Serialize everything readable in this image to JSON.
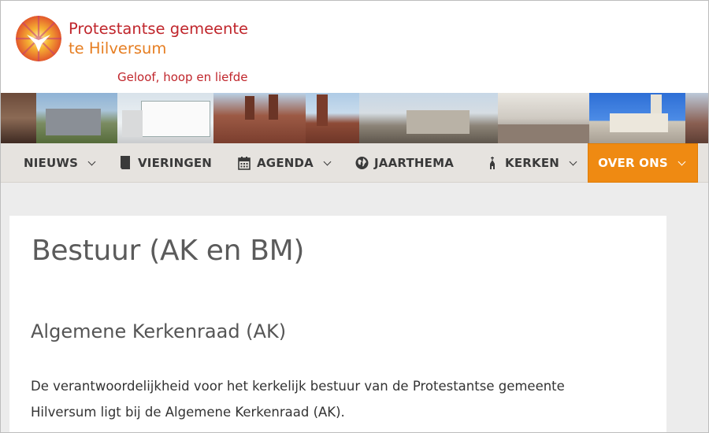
{
  "header": {
    "site_name_line1": "Protestantse gemeente",
    "site_name_line2": "te Hilversum",
    "tagline": "Geloof, hoop en liefde"
  },
  "nav": {
    "items": [
      {
        "label": "NIEUWS",
        "icon": "none",
        "dropdown": true
      },
      {
        "label": "VIERINGEN",
        "icon": "book-icon",
        "dropdown": false
      },
      {
        "label": "AGENDA",
        "icon": "calendar-icon",
        "dropdown": true
      },
      {
        "label": "JAARTHEMA",
        "icon": "globe-icon",
        "dropdown": false
      },
      {
        "label": "KERKEN",
        "icon": "church-icon",
        "dropdown": true
      },
      {
        "label": "OVER ONS",
        "icon": "none",
        "dropdown": true
      }
    ]
  },
  "main": {
    "page_title": "Bestuur (AK en BM)",
    "section_heading": "Algemene Kerkenraad (AK)",
    "paragraph_line1": "De verantwoordelijkheid voor het kerkelijk bestuur van de Protestantse gemeente",
    "paragraph_line2": "Hilversum ligt bij de Algemene Kerkenraad (AK)."
  },
  "colors": {
    "brand_red": "#c0262c",
    "brand_orange": "#e67e22",
    "nav_active": "#ef8a12",
    "nav_bg": "#e6e3df"
  }
}
